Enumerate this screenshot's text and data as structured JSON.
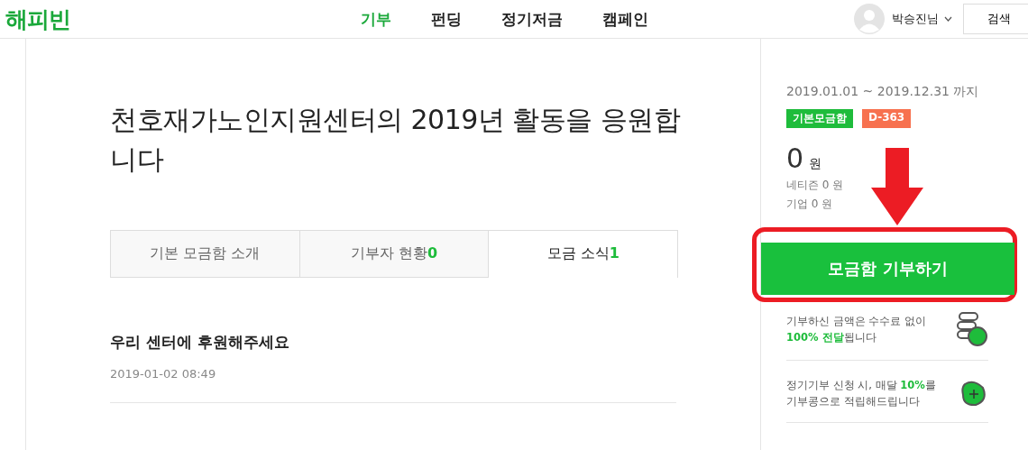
{
  "header": {
    "logo": "해피빈",
    "nav": [
      {
        "label": "기부",
        "selected": true
      },
      {
        "label": "펀딩",
        "selected": false
      },
      {
        "label": "정기저금",
        "selected": false
      },
      {
        "label": "캠페인",
        "selected": false
      }
    ],
    "user": "박승진님",
    "search_button": "검색"
  },
  "main": {
    "title": "천호재가노인지원센터의 2019년 활동을 응원합니다",
    "tabs": [
      {
        "label": "기본 모금함 소개",
        "selected": false
      },
      {
        "label": "기부자 현황",
        "count": "0",
        "selected": false
      },
      {
        "label": "모금 소식",
        "count": "1",
        "selected": true
      }
    ],
    "post": {
      "title": "우리 센터에 후원해주세요",
      "date": "2019-01-02 08:49"
    }
  },
  "sidebar": {
    "period": "2019.01.01 ~ 2019.12.31 까지",
    "badges": [
      {
        "label": "기본모금함",
        "color": "#1ebc3b"
      },
      {
        "label": "D-363",
        "color": "#f7714f"
      }
    ],
    "amount": "0",
    "amount_unit": "원",
    "breakdown": [
      "네티즌 0 원",
      "기업 0 원"
    ],
    "donate_button": "모금함 기부하기",
    "info": [
      {
        "text": "기부하신 금액은 수수료 없이 **100% 전달**됩니다",
        "kind": "coins"
      },
      {
        "text": "정기기부 신청 시, 매달 **10%**를 기부콩으로 적립해드립니다",
        "kind": "bean"
      }
    ]
  }
}
